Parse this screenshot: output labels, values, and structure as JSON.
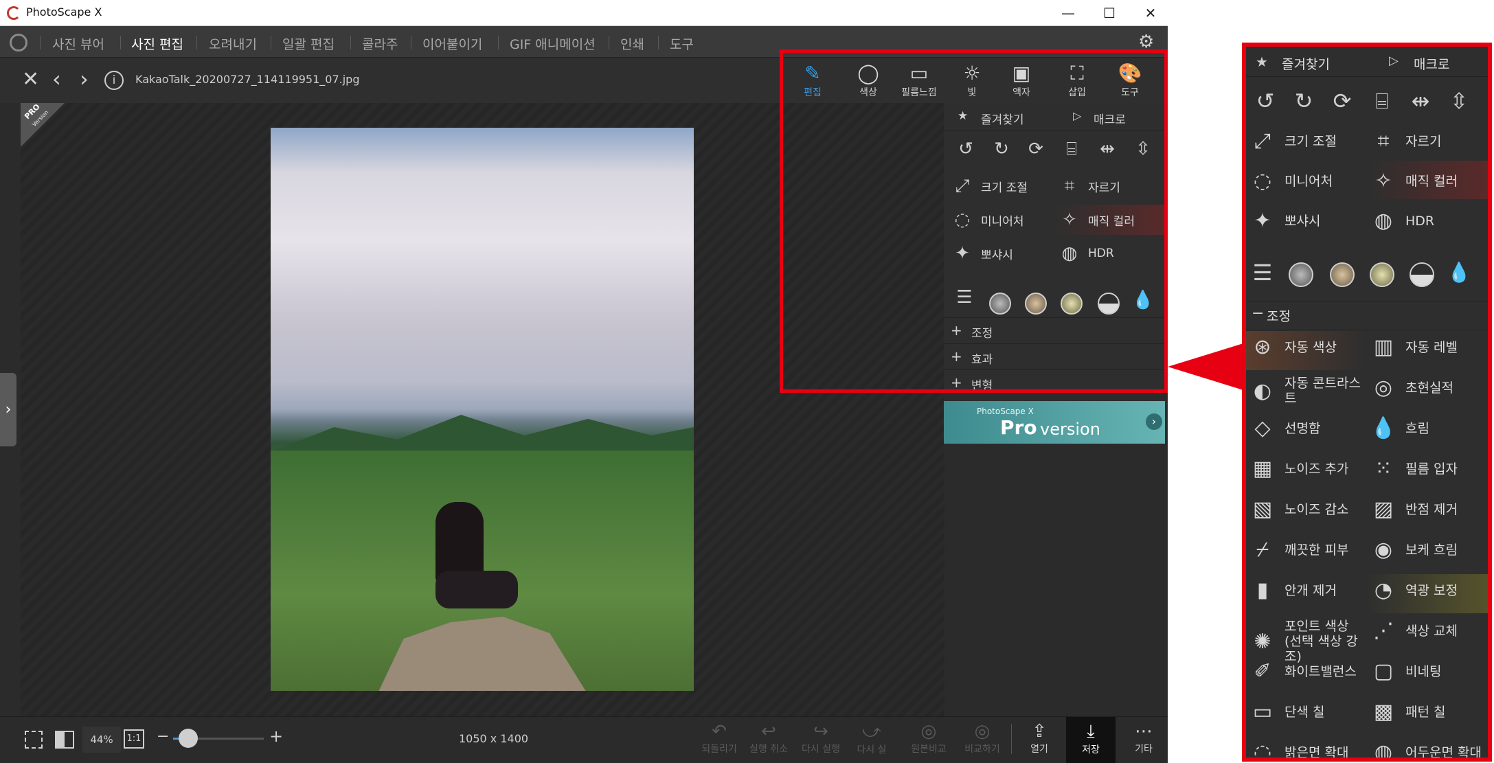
{
  "window": {
    "title": "PhotoScape X",
    "minimize": "—",
    "maximize": "☐",
    "close": "✕"
  },
  "menu": [
    "사진 뷰어",
    "사진 편집",
    "오려내기",
    "일괄 편집",
    "콜라주",
    "이어붙이기",
    "GIF 애니메이션",
    "인쇄",
    "도구"
  ],
  "file": {
    "name": "KakaoTalk_20200727_114119951_07.jpg"
  },
  "pro_badge": {
    "line1": "PRO",
    "line2": "Version"
  },
  "tools": [
    "편집",
    "색상",
    "필름느낌",
    "빛",
    "액자",
    "삽입",
    "도구"
  ],
  "panel": {
    "favorites": "즐겨찾기",
    "macro": "매크로",
    "cells": [
      {
        "label": "크기 조절",
        "icon": "resize-icon"
      },
      {
        "label": "자르기",
        "icon": "crop-icon"
      },
      {
        "label": "미니어처",
        "icon": "miniature-icon"
      },
      {
        "label": "매직 컬러",
        "icon": "magic-wand-icon"
      },
      {
        "label": "뽀샤시",
        "icon": "sparkle-icon"
      },
      {
        "label": "HDR",
        "icon": "hdr-icon"
      }
    ],
    "sections": [
      "조정",
      "효과",
      "변형"
    ]
  },
  "pro_banner": {
    "small": "PhotoScape X",
    "big": "Pro",
    "rest": " version"
  },
  "bottom": {
    "zoom": "44%",
    "one_to_one": "1:1",
    "dimensions": "1050 x 1400",
    "actions": [
      "되돌리기",
      "실행 취소",
      "다시 실행",
      "다시 실",
      "원본비교",
      "비교하기"
    ],
    "open": "열기",
    "save": "저장",
    "more": "기타"
  },
  "zoom_panel": {
    "favorites": "즐겨찾기",
    "macro": "매크로",
    "top_cells": [
      {
        "label": "크기 조절"
      },
      {
        "label": "자르기"
      },
      {
        "label": "미니어처"
      },
      {
        "label": "매직 컬러"
      },
      {
        "label": "뽀샤시"
      },
      {
        "label": "HDR"
      }
    ],
    "section": "조정",
    "items": [
      {
        "label": "자동 색상",
        "icon": "auto-color-icon"
      },
      {
        "label": "자동 레벨",
        "icon": "auto-level-icon"
      },
      {
        "label": "자동 콘트라스트",
        "icon": "auto-contrast-icon"
      },
      {
        "label": "초현실적",
        "icon": "surreal-icon"
      },
      {
        "label": "선명함",
        "icon": "sharpen-icon"
      },
      {
        "label": "흐림",
        "icon": "blur-icon"
      },
      {
        "label": "노이즈 추가",
        "icon": "add-noise-icon"
      },
      {
        "label": "필름 입자",
        "icon": "film-grain-icon"
      },
      {
        "label": "노이즈 감소",
        "icon": "reduce-noise-icon"
      },
      {
        "label": "반점 제거",
        "icon": "spot-removal-icon"
      },
      {
        "label": "깨끗한 피부",
        "icon": "clean-skin-icon"
      },
      {
        "label": "보케 흐림",
        "icon": "bokeh-icon"
      },
      {
        "label": "안개 제거",
        "icon": "dehaze-icon"
      },
      {
        "label": "역광 보정",
        "icon": "backlight-icon"
      },
      {
        "label": "포인트 색상 (선택 색상 강조)",
        "icon": "point-color-icon"
      },
      {
        "label": "색상 교체",
        "icon": "color-replace-icon"
      },
      {
        "label": "화이트밸런스",
        "icon": "white-balance-icon"
      },
      {
        "label": "비네팅",
        "icon": "vignette-icon"
      },
      {
        "label": "단색 칠",
        "icon": "solid-fill-icon"
      },
      {
        "label": "패턴 칠",
        "icon": "pattern-fill-icon"
      },
      {
        "label": "밝은면 확대",
        "icon": "expand-light-icon"
      },
      {
        "label": "어두운면 확대",
        "icon": "expand-dark-icon"
      }
    ]
  },
  "colors": {
    "highlight": "#e60012",
    "accent": "#3a9be0",
    "bg": "#2b2b2b"
  }
}
